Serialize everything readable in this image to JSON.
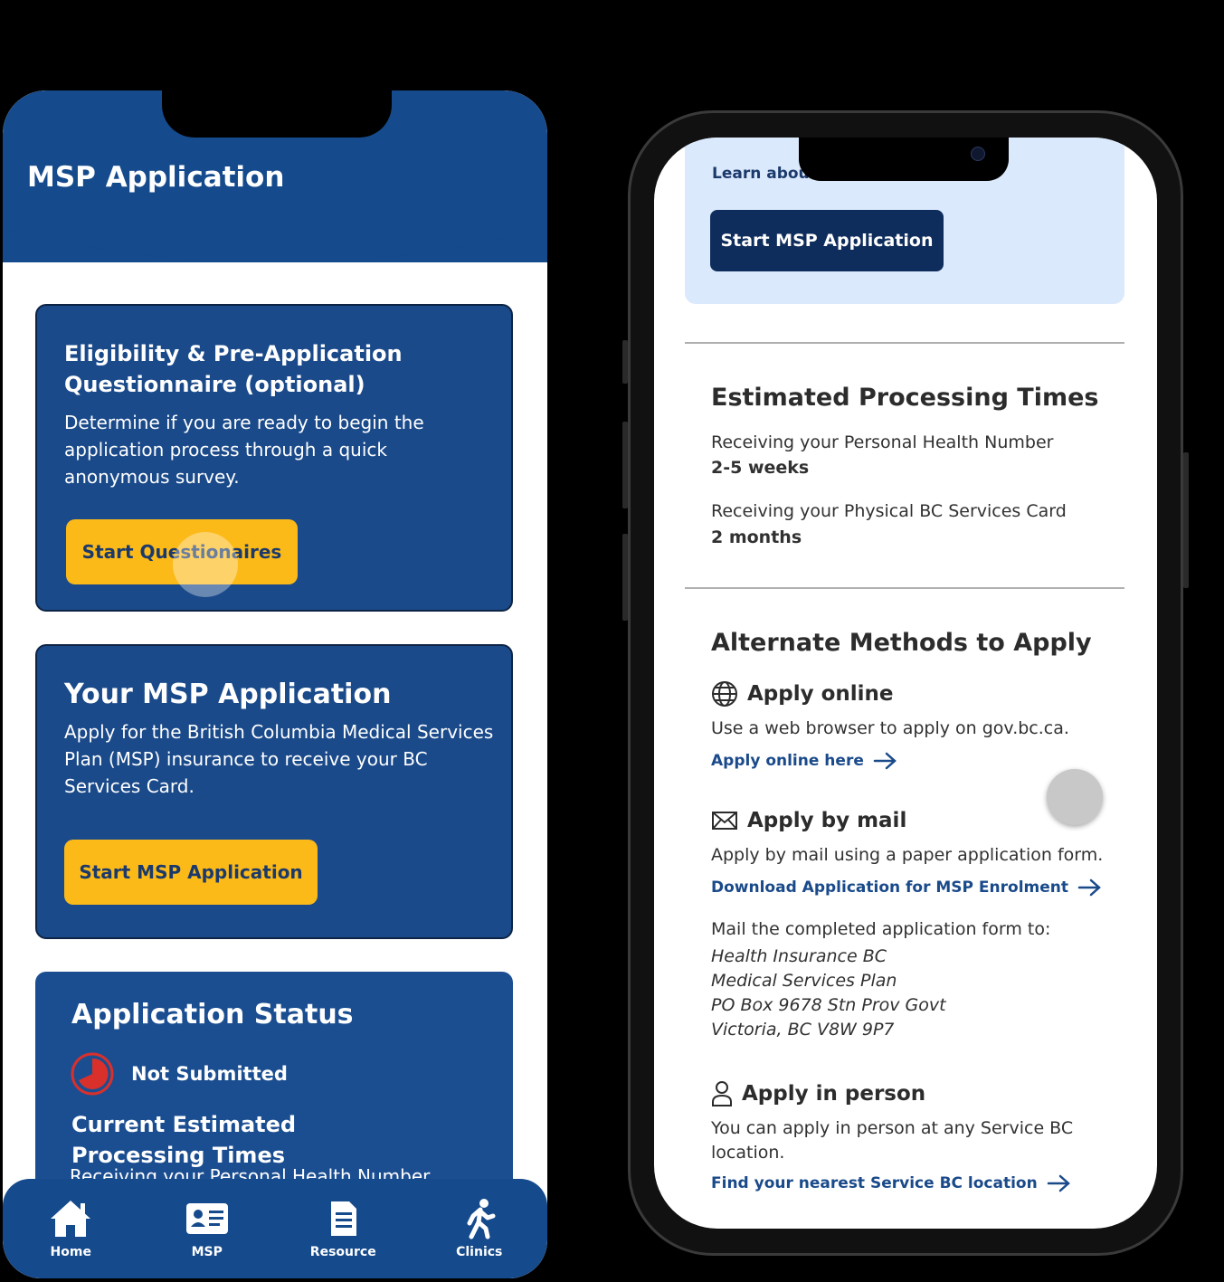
{
  "left": {
    "header": {
      "title": "MSP Application",
      "color": "#154a8c"
    },
    "card1": {
      "title": "Eligibility & Pre-Application Questionnaire (optional)",
      "desc": "Determine if you are ready to begin the application process through a quick anonymous survey.",
      "button": "Start Questionaires"
    },
    "card2": {
      "title": "Your MSP Application",
      "desc": "Apply for the British Columbia Medical Services Plan (MSP) insurance to receive your BC Services Card.",
      "button": "Start MSP Application"
    },
    "card3": {
      "title": "Application Status",
      "status": "Not Submitted",
      "subtitle": "Current Estimated Processing Times",
      "cut_text": "Receiving your Personal Health Number"
    },
    "nav": [
      {
        "label": "Home",
        "icon": "home-icon"
      },
      {
        "label": "MSP",
        "icon": "id-card-icon"
      },
      {
        "label": "Resource",
        "icon": "document-icon"
      },
      {
        "label": "Clinics",
        "icon": "walking-person-icon"
      }
    ],
    "accent": "#fcba19"
  },
  "right": {
    "top": {
      "learn_link": "Learn about MSP",
      "button": "Start MSP Application"
    },
    "processing": {
      "title": "Estimated Processing Times",
      "phn_label": "Receiving your Personal Health Number",
      "phn_value": "2-5 weeks",
      "card_label": "Receiving your Physical BC Services Card",
      "card_value": "2 months"
    },
    "alternate": {
      "title": "Alternate Methods to Apply",
      "online_title": "Apply online",
      "online_desc": "Use a web browser to apply on gov.bc.ca.",
      "online_link": "Apply online here",
      "mail_title": "Apply by mail",
      "mail_desc": "Apply by mail using a paper application form.",
      "mail_link": "Download Application for MSP Enrolment",
      "mail_to": "Mail the completed application form to:",
      "address": [
        "Health Insurance BC",
        "Medical Services Plan",
        "PO Box 9678 Stn Prov Govt",
        "Victoria, BC V8W 9P7"
      ],
      "person_title": "Apply in person",
      "person_desc": "You can apply in person at any Service BC location.",
      "person_link": "Find your nearest Service BC location"
    }
  }
}
